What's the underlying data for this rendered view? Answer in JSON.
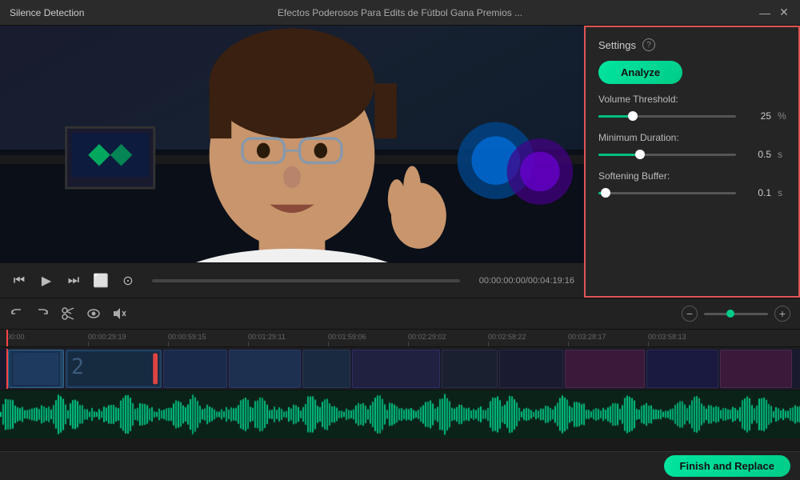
{
  "titlebar": {
    "title": "Silence Detection",
    "video_title": "Efectos Poderosos Para Edits de Fútbol  Gana Premios ...",
    "minimize_label": "—",
    "close_label": "✕"
  },
  "controls": {
    "time_current": "00:00:00:00",
    "time_total": "00:04:19:16",
    "time_display": "00:00:00:00/00:04:19:16"
  },
  "settings": {
    "title": "Settings",
    "help_label": "?",
    "analyze_label": "Analyze",
    "volume_threshold_label": "Volume Threshold:",
    "volume_threshold_value": "25",
    "volume_threshold_unit": "%",
    "volume_threshold_pct": 25,
    "minimum_duration_label": "Minimum Duration:",
    "minimum_duration_value": "0.5",
    "minimum_duration_unit": "s",
    "minimum_duration_pct": 30,
    "softening_buffer_label": "Softening Buffer:",
    "softening_buffer_value": "0.1",
    "softening_buffer_unit": "s",
    "softening_buffer_pct": 5
  },
  "toolbar": {
    "undo_label": "↩",
    "redo_label": "↪",
    "cut_label": "✂",
    "eye_label": "👁",
    "mute_label": "🔇"
  },
  "timeline": {
    "markers": [
      {
        "label": "00:00",
        "left_pct": 0.8
      },
      {
        "label": "00:00:29:19",
        "left_pct": 11
      },
      {
        "label": "00:00:59:15",
        "left_pct": 21
      },
      {
        "label": "00:01:29:11",
        "left_pct": 31
      },
      {
        "label": "00:01:59:06",
        "left_pct": 41
      },
      {
        "label": "00:02:29:02",
        "left_pct": 51
      },
      {
        "label": "00:02:58:22",
        "left_pct": 61
      },
      {
        "label": "00:03:28:17",
        "left_pct": 71
      },
      {
        "label": "00:03:58:13",
        "left_pct": 81
      }
    ]
  },
  "bottom": {
    "finish_label": "Finish and Replace"
  }
}
